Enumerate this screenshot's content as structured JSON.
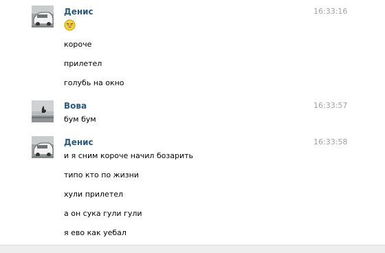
{
  "messages": [
    {
      "author": "Денис",
      "time": "16:33:16",
      "avatar_icon": "car-photo-icon",
      "emoji_icon": "laughing-emoji-icon",
      "lines": [
        "короче",
        "прилетел",
        "голубь на окно"
      ]
    },
    {
      "author": "Вова",
      "time": "16:33:57",
      "avatar_icon": "gray-photo-icon",
      "lines": [
        "бум бум"
      ]
    },
    {
      "author": "Денис",
      "time": "16:33:58",
      "avatar_icon": "car-photo-icon",
      "lines": [
        "и я сним короче начил бозарить",
        "типо кто по жизни",
        "хули прилетел",
        "а он сука гули гули",
        "я ево как уебал"
      ]
    }
  ],
  "colors": {
    "author": "#2b587a",
    "time": "#a2a2a2",
    "text": "#000000"
  }
}
